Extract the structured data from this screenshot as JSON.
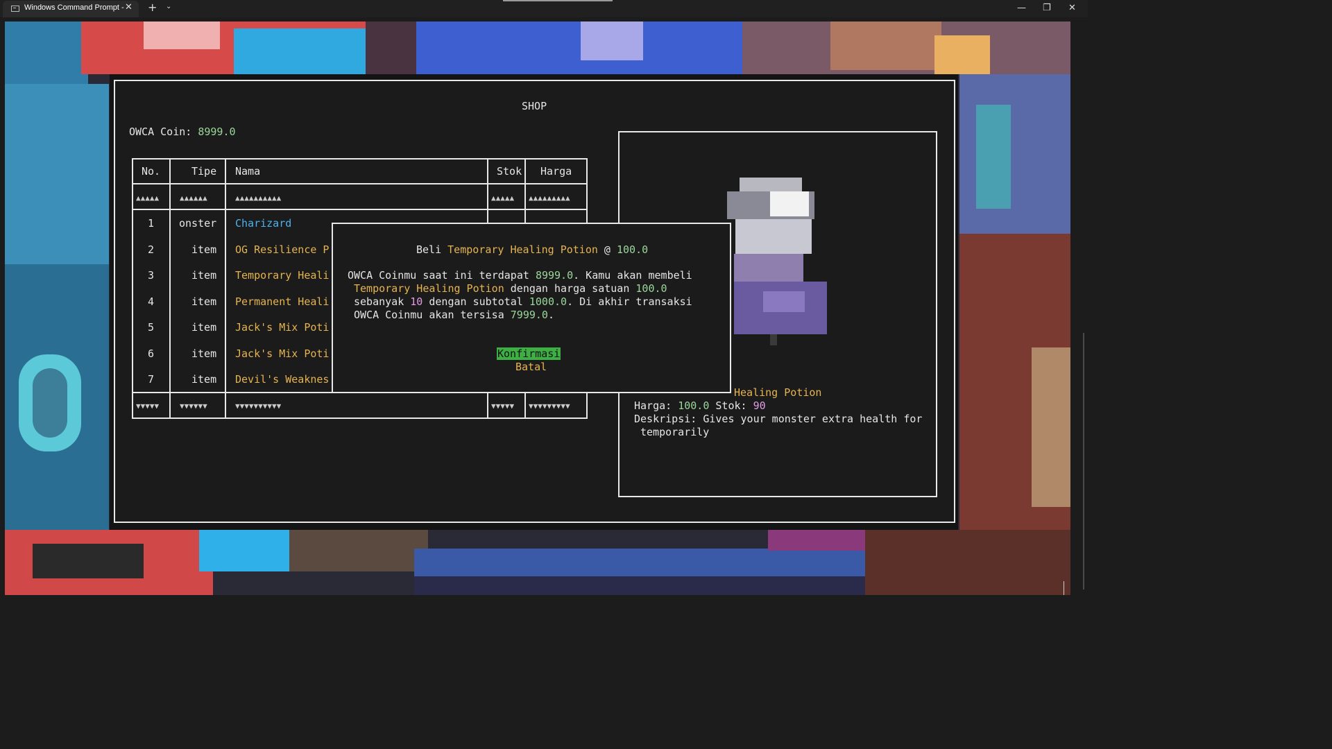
{
  "window": {
    "tab_title": "Windows Command Prompt -",
    "tab_close": "✕",
    "new_tab": "+",
    "tab_dropdown": "⌄",
    "minimize": "—",
    "maximize": "❐",
    "close": "✕"
  },
  "shop": {
    "title": "SHOP",
    "coin_label": "OWCA Coin: ",
    "coin_value": "8999.0"
  },
  "table": {
    "headers": {
      "no": "No.",
      "tipe": "Tipe",
      "nama": "Nama",
      "stok": "Stok",
      "harga": "Harga"
    },
    "up_arrows": {
      "no": "▲▲▲▲▲",
      "tipe": "▲▲▲▲▲▲",
      "nama": "▲▲▲▲▲▲▲▲▲▲",
      "stok": "▲▲▲▲▲",
      "harga": "▲▲▲▲▲▲▲▲▲"
    },
    "down_arrows": {
      "no": "▼▼▼▼▼",
      "tipe": "▼▼▼▼▼▼",
      "nama": "▼▼▼▼▼▼▼▼▼▼",
      "stok": "▼▼▼▼▼",
      "harga": "▼▼▼▼▼▼▼▼▼"
    },
    "rows": [
      {
        "no": "1",
        "tipe": "onster",
        "nama": "Charizard"
      },
      {
        "no": "2",
        "tipe": "item",
        "nama": "OG Resilience P"
      },
      {
        "no": "3",
        "tipe": "item",
        "nama": "Temporary Heali"
      },
      {
        "no": "4",
        "tipe": "item",
        "nama": "Permanent Heali"
      },
      {
        "no": "5",
        "tipe": "item",
        "nama": "Jack's Mix Poti"
      },
      {
        "no": "6",
        "tipe": "item",
        "nama": "Jack's Mix Poti"
      },
      {
        "no": "7",
        "tipe": "item",
        "nama": "Devil's Weaknes"
      }
    ]
  },
  "detail": {
    "name_visible": "Healing Potion",
    "harga_label": "Harga: ",
    "harga_value": "100.0",
    "stok_label": " Stok: ",
    "stok_value": "90",
    "desc_label": "Deskripsi: ",
    "desc_line1": "Gives your monster extra health for",
    "desc_line2": "temporarily"
  },
  "modal": {
    "line0_a": "Beli ",
    "line0_item": "Temporary Healing Potion",
    "line0_b": " @ ",
    "line0_price": "100.0",
    "line1_a": "OWCA Coinmu saat ini terdapat ",
    "line1_coin": "8999.0",
    "line1_b": ". Kamu akan membeli",
    "line2_item": "Temporary Healing Potion",
    "line2_b": " dengan harga satuan ",
    "line2_price": "100.0",
    "line3_a": "sebanyak ",
    "line3_qty": "10",
    "line3_b": " dengan subtotal ",
    "line3_subtotal": "1000.0",
    "line3_c": ". Di akhir transaksi",
    "line4_a": "OWCA Coinmu akan tersisa ",
    "line4_rest": "7999.0",
    "line4_b": ".",
    "confirm": "Konfirmasi",
    "cancel": "Batal"
  },
  "colors": {
    "coin_green": "#9ad79a",
    "item_yellow": "#e6b450",
    "monster_blue": "#4db2f0",
    "qty_pink": "#e29ce6",
    "confirm_bg": "#3cb043"
  }
}
